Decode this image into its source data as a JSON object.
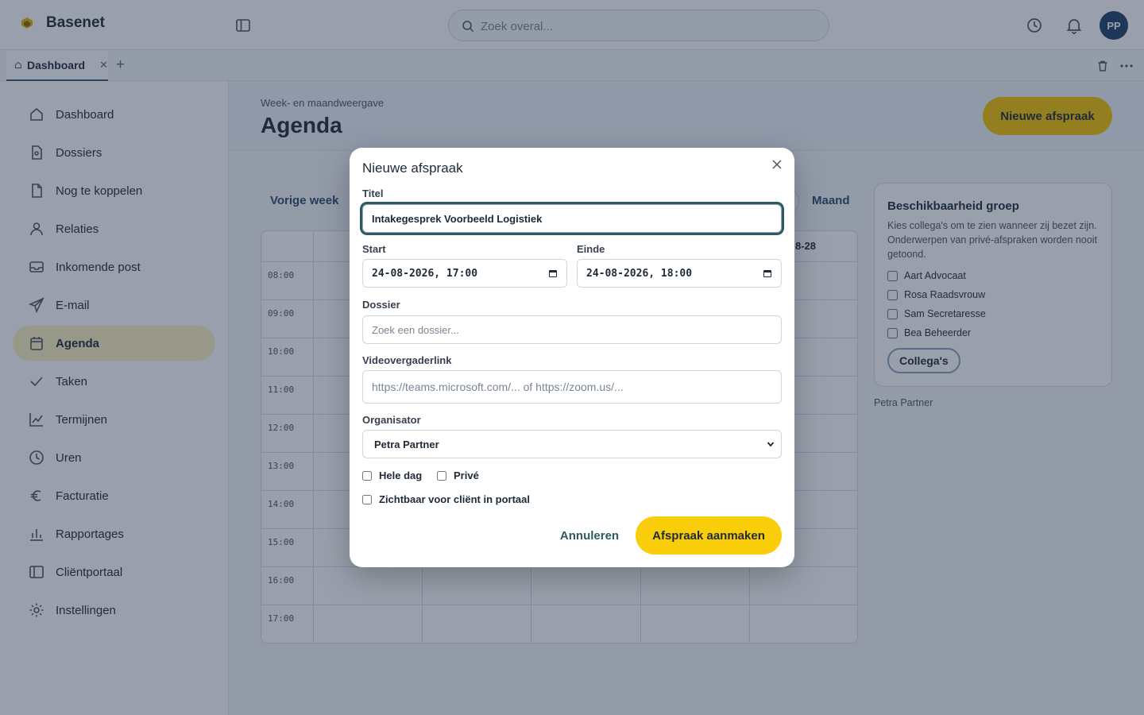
{
  "app": {
    "name": "Basenet"
  },
  "search": {
    "placeholder": "Zoek overal..."
  },
  "user": {
    "initials": "PP"
  },
  "tabs": [
    {
      "label": "Dashboard"
    }
  ],
  "sidebar": {
    "items": [
      {
        "label": "Dashboard",
        "icon": "home-icon"
      },
      {
        "label": "Dossiers",
        "icon": "file-icon"
      },
      {
        "label": "Nog te koppelen",
        "icon": "document-icon"
      },
      {
        "label": "Relaties",
        "icon": "user-icon"
      },
      {
        "label": "Inkomende post",
        "icon": "inbox-icon"
      },
      {
        "label": "E-mail",
        "icon": "send-icon"
      },
      {
        "label": "Agenda",
        "icon": "calendar-icon",
        "active": true
      },
      {
        "label": "Taken",
        "icon": "check-icon"
      },
      {
        "label": "Termijnen",
        "icon": "chart-line-icon"
      },
      {
        "label": "Uren",
        "icon": "clock-icon"
      },
      {
        "label": "Facturatie",
        "icon": "euro-icon"
      },
      {
        "label": "Rapportages",
        "icon": "bar-chart-icon"
      },
      {
        "label": "Cliëntportaal",
        "icon": "portal-icon"
      },
      {
        "label": "Instellingen",
        "icon": "gear-icon"
      }
    ]
  },
  "page": {
    "subtitle": "Week- en maandweergave",
    "title": "Agenda",
    "new_button": "Nieuwe afspraak"
  },
  "calendar": {
    "prev_week": "Vorige week",
    "month": "Maand",
    "visible_date": "8-28",
    "times": [
      "08:00",
      "09:00",
      "10:00",
      "11:00",
      "12:00",
      "13:00",
      "14:00",
      "15:00",
      "16:00",
      "17:00"
    ]
  },
  "availability": {
    "title": "Beschikbaarheid groep",
    "description": "Kies collega's om te zien wanneer zij bezet zijn. Onderwerpen van privé-afspraken worden nooit getoond.",
    "colleagues": [
      "Aart Advocaat",
      "Rosa Raadsvrouw",
      "Sam Secretaresse",
      "Bea Beheerder"
    ],
    "button": "Collega's",
    "current_user": "Petra Partner"
  },
  "modal": {
    "title": "Nieuwe afspraak",
    "title_label": "Titel",
    "title_value": "Intakegesprek Voorbeeld Logistiek",
    "start_label": "Start",
    "start_value": "24-08-2026, 17:00",
    "end_label": "Einde",
    "end_value": "24-08-2026, 18:00",
    "dossier_label": "Dossier",
    "dossier_placeholder": "Zoek een dossier...",
    "video_label": "Videovergaderlink",
    "video_placeholder": "https://teams.microsoft.com/... of https://zoom.us/...",
    "organizer_label": "Organisator",
    "organizer_value": "Petra Partner",
    "all_day_label": "Hele dag",
    "private_label": "Privé",
    "portal_label": "Zichtbaar voor cliënt in portaal",
    "cancel_label": "Annuleren",
    "create_label": "Afspraak aanmaken"
  },
  "colors": {
    "accent": "#f9cd0a",
    "brand_dark": "#1f3f66",
    "focus_ring": "#2e5b63"
  }
}
